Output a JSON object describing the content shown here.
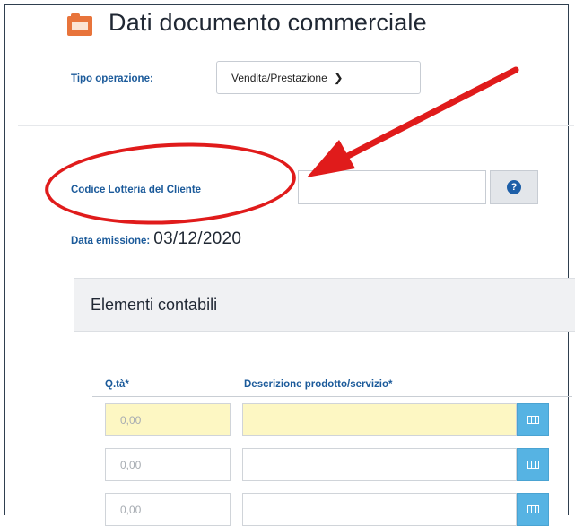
{
  "header": {
    "title": "Dati documento commerciale"
  },
  "tipo_operazione": {
    "label": "Tipo operazione:",
    "selected": "Vendita/Prestazione"
  },
  "codice_lotteria": {
    "label": "Codice Lotteria del Cliente",
    "value": "",
    "help": "?"
  },
  "data_emissione": {
    "label": "Data emissione:",
    "value": "03/12/2020"
  },
  "elementi_contabili": {
    "title": "Elementi contabili",
    "columns": [
      "Q.tà*",
      "Descrizione prodotto/servizio*"
    ],
    "rows": [
      {
        "qta": "0,00",
        "descrizione": ""
      },
      {
        "qta": "0,00",
        "descrizione": ""
      },
      {
        "qta": "0,00",
        "descrizione": ""
      }
    ]
  },
  "colors": {
    "annotation": "#e01b1b",
    "label_blue": "#1b5a9a",
    "button_blue": "#56b3e3",
    "highlight": "#fdf7c3",
    "folder": "#e8743b"
  }
}
